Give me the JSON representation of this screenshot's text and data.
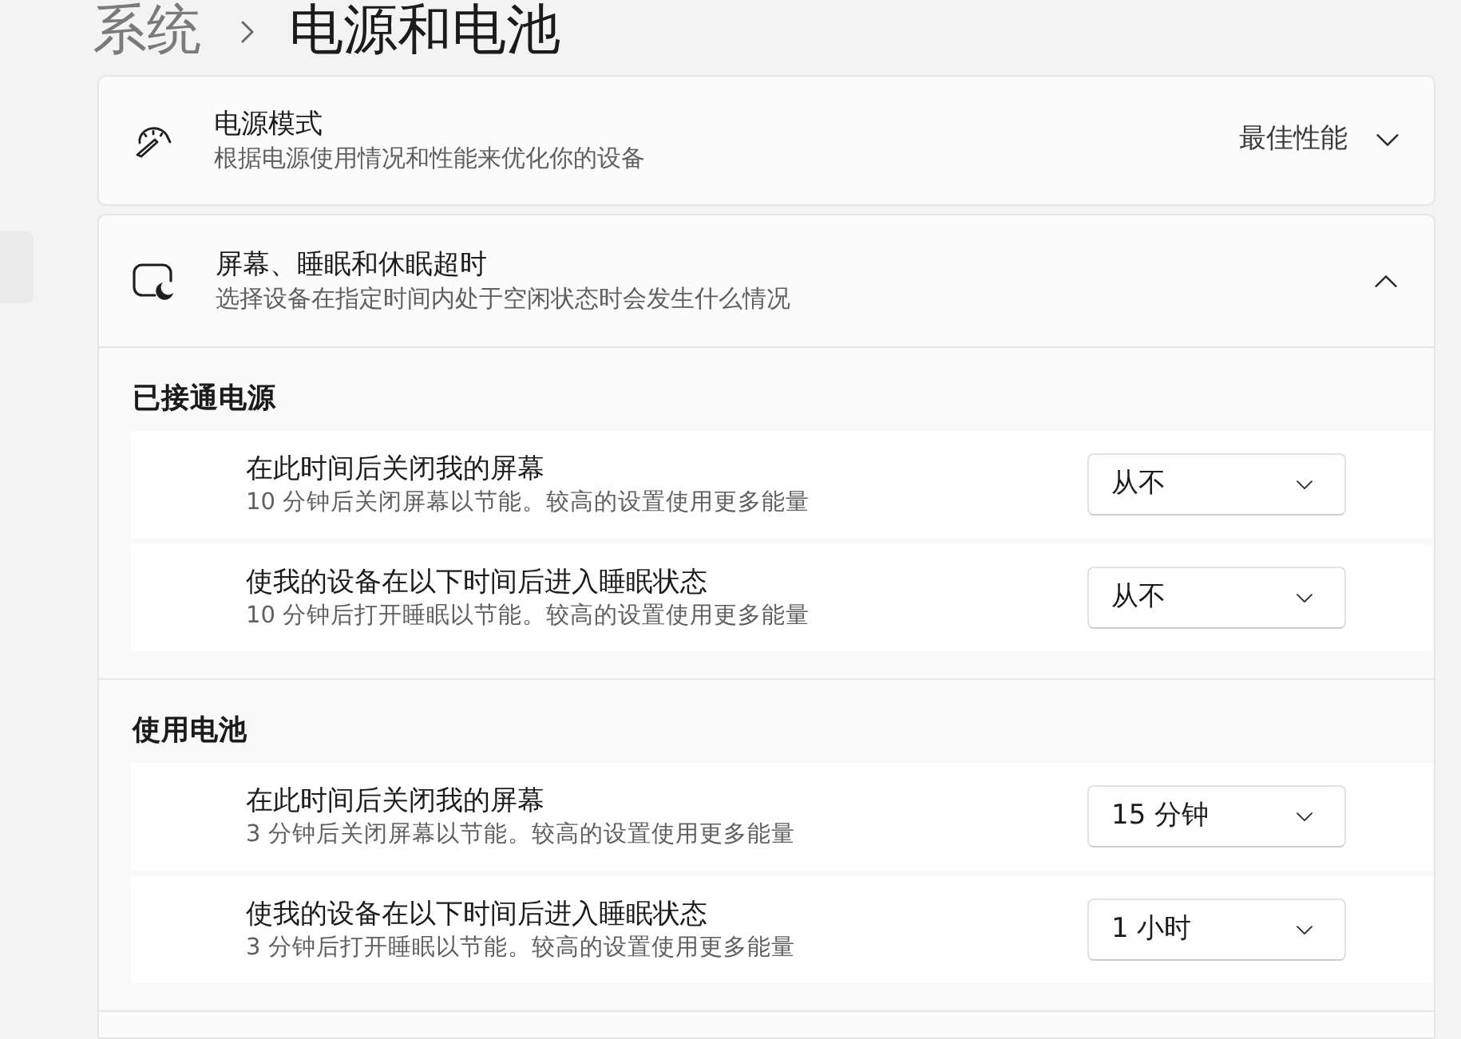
{
  "breadcrumb": {
    "parent": "系统",
    "current": "电源和电池"
  },
  "settings": [
    {
      "kind": "dropdown",
      "title": "电源模式",
      "description": "根据电源使用情况和性能来优化你的设备",
      "value": "最佳性能",
      "expanded": false
    },
    {
      "kind": "expander",
      "title": "屏幕、睡眠和休眠超时",
      "description": "选择设备在指定时间内处于空闲状态时会发生什么情况",
      "expanded": true,
      "groups": [
        {
          "heading": "已接通电源",
          "items": [
            {
              "title": "在此时间后关闭我的屏幕",
              "description": "10 分钟后关闭屏幕以节能。较高的设置使用更多能量",
              "value": "从不"
            },
            {
              "title": "使我的设备在以下时间后进入睡眠状态",
              "description": "10 分钟后打开睡眠以节能。较高的设置使用更多能量",
              "value": "从不"
            }
          ]
        },
        {
          "heading": "使用电池",
          "items": [
            {
              "title": "在此时间后关闭我的屏幕",
              "description": "3 分钟后关闭屏幕以节能。较高的设置使用更多能量",
              "value": "15 分钟"
            },
            {
              "title": "使我的设备在以下时间后进入睡眠状态",
              "description": "3 分钟后打开睡眠以节能。较高的设置使用更多能量",
              "value": "1 小时"
            }
          ]
        }
      ]
    }
  ]
}
